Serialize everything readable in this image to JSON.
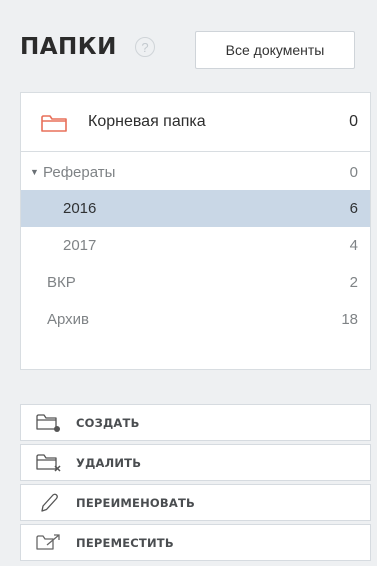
{
  "header": {
    "title": "ПАПКИ",
    "help_glyph": "?",
    "all_docs_label": "Все документы"
  },
  "folders": {
    "root": {
      "label": "Корневая папка",
      "count": "0",
      "icon": "folder-icon",
      "icon_color": "#e8705a"
    },
    "items": [
      {
        "label": "Рефераты",
        "count": "0",
        "expanded": true
      },
      {
        "label": "2016",
        "count": "6",
        "selected": true
      },
      {
        "label": "2017",
        "count": "4"
      },
      {
        "label": "ВКР",
        "count": "2"
      },
      {
        "label": "Архив",
        "count": "18"
      }
    ],
    "selected_color": "#c9d7e6"
  },
  "actions": [
    {
      "label": "СОЗДАТЬ",
      "icon": "folder-add-icon"
    },
    {
      "label": "УДАЛИТЬ",
      "icon": "folder-delete-icon"
    },
    {
      "label": "ПЕРЕИМЕНОВАТЬ",
      "icon": "pencil-icon"
    },
    {
      "label": "ПЕРЕМЕСТИТЬ",
      "icon": "folder-move-icon"
    }
  ]
}
